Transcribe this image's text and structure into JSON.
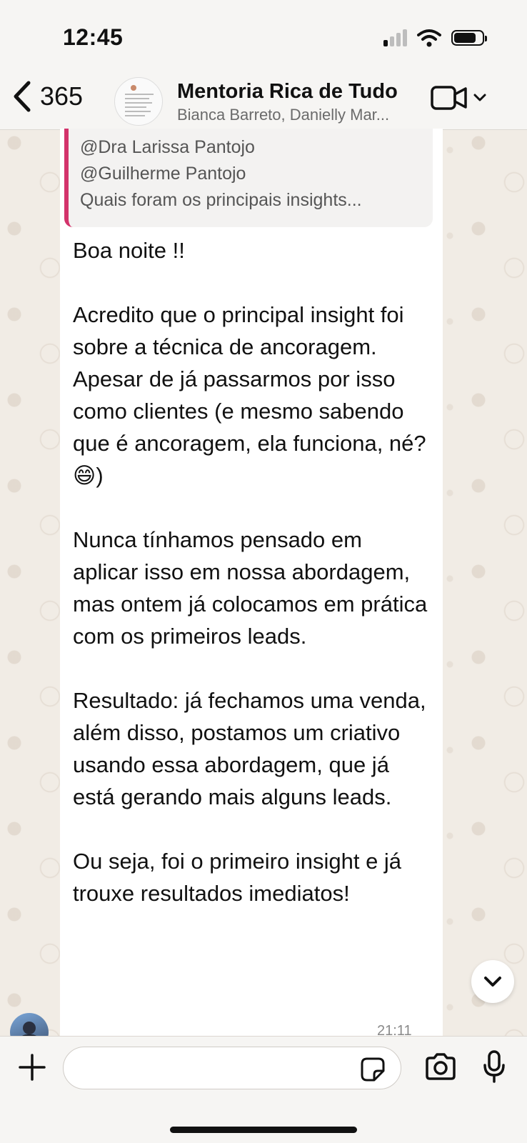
{
  "status_bar": {
    "time": "12:45"
  },
  "header": {
    "back_count": "365",
    "group_name": "Mentoria Rica de Tudo",
    "members": "Bianca Barreto, Danielly Mar..."
  },
  "message": {
    "quote_lines": [
      "@Dra Larissa Pantojo",
      "@Guilherme Pantojo",
      "Quais foram os principais insights..."
    ],
    "text": "Boa noite !!\n\nAcredito que o principal insight foi sobre a técnica de ancoragem. Apesar de já passarmos por isso como clientes (e mesmo sabendo que é ancoragem, ela funciona, né? 😄)\n\nNunca tínhamos pensado em aplicar isso em nossa abordagem, mas ontem já colocamos em prática com os primeiros leads.\n\nResultado: já fechamos uma venda, além disso, postamos um criativo usando essa abordagem, que já está gerando mais alguns leads.\n\nOu seja, foi o primeiro insight e já trouxe resultados imediatos!",
    "time": "21:11"
  },
  "composer": {
    "value": "",
    "placeholder": ""
  },
  "icons": {
    "back": "chevron-left-icon",
    "video": "video-camera-icon",
    "dropdown": "chevron-down-icon",
    "scroll": "chevron-down-icon",
    "plus": "plus-icon",
    "sticker": "sticker-icon",
    "camera": "camera-icon",
    "mic": "microphone-icon"
  },
  "colors": {
    "quote_accent": "#d3336b",
    "bubble": "#ffffff",
    "wallpaper": "#f1ece5"
  }
}
